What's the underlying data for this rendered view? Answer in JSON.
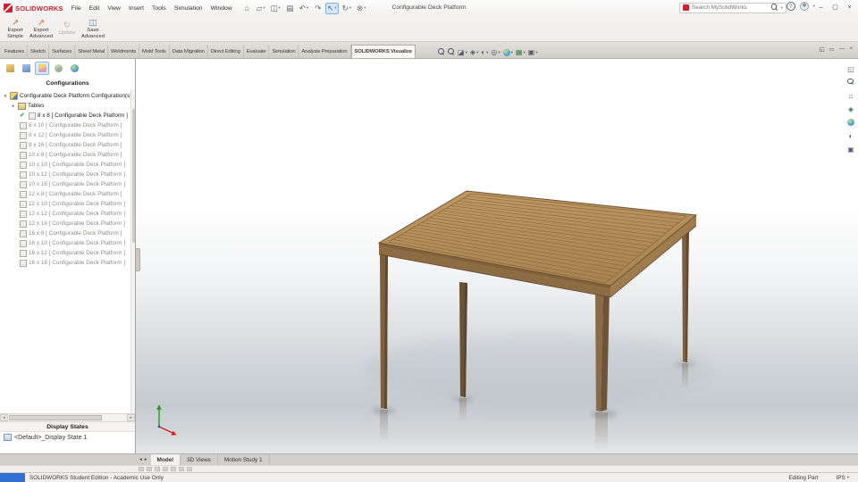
{
  "colors": {
    "brand_red": "#cf2030",
    "check_green": "#1e9b3a",
    "selection_blue": "#7fb0e0",
    "taskbar_blue": "#2f6fd6",
    "wood_top": "#b8935f",
    "wood_shadow": "#6d5438",
    "axis_x": "#d22020",
    "axis_y": "#1f9e1f",
    "axis_z": "#2b55cf"
  },
  "ui": {
    "caret_down": "▾",
    "caret_expanded": "▾",
    "caret_collapsed": "▸",
    "check": "✔",
    "arrow_left": "◂",
    "arrow_right": "▸"
  },
  "titlebar": {
    "logo_text": "SOLIDWORKS",
    "menus": [
      "File",
      "Edit",
      "View",
      "Insert",
      "Tools",
      "Simulation",
      "Window"
    ],
    "toolbar_icons": [
      {
        "name": "home",
        "glyph": "⌂"
      },
      {
        "name": "open",
        "glyph": "▱"
      },
      {
        "name": "save",
        "glyph": "◫"
      },
      {
        "name": "print",
        "glyph": "▤"
      },
      {
        "name": "undo",
        "glyph": "↶"
      },
      {
        "name": "redo",
        "glyph": "↷"
      },
      {
        "name": "select",
        "glyph": "↖"
      },
      {
        "name": "rebuild",
        "glyph": "↻"
      },
      {
        "name": "options",
        "glyph": "⊛"
      }
    ],
    "document_title": "Configurable Deck Platform",
    "search_placeholder": "Search MySolidWorks",
    "help_glyph": "?",
    "window_controls": {
      "minimize": "–",
      "maximize": "▢",
      "close": "×"
    }
  },
  "ribbon": {
    "buttons": [
      {
        "line1": "Export",
        "line2": "Simple",
        "glyph": "↗",
        "disabled": false
      },
      {
        "line1": "Export",
        "line2": "Advanced",
        "glyph": "↗",
        "disabled": false
      },
      {
        "line1": "Update",
        "line2": "",
        "glyph": "↻",
        "disabled": true
      },
      {
        "line1": "Save",
        "line2": "Advanced",
        "glyph": "◫",
        "disabled": false
      }
    ]
  },
  "command_tabs": {
    "items": [
      "Features",
      "Sketch",
      "Surfaces",
      "Sheet Metal",
      "Weldments",
      "Mold Tools",
      "Data Migration",
      "Direct Editing",
      "Evaluate",
      "Simulation",
      "Analysis Preparation",
      "SOLIDWORKS Visualize"
    ],
    "active": "SOLIDWORKS Visualize"
  },
  "headsup_icons": [
    {
      "name": "zoom-fit",
      "glyph": ""
    },
    {
      "name": "zoom-area",
      "glyph": ""
    },
    {
      "name": "section-view",
      "glyph": "◪"
    },
    {
      "name": "view-orientation",
      "glyph": "◈"
    },
    {
      "name": "display-style",
      "glyph": "◐"
    },
    {
      "name": "hide-show-items",
      "glyph": "◎"
    },
    {
      "name": "edit-appearance",
      "glyph": ""
    },
    {
      "name": "scene",
      "glyph": "▦"
    },
    {
      "name": "view-settings",
      "glyph": "▣"
    }
  ],
  "pane_controls": [
    {
      "name": "pop-out",
      "glyph": "◱"
    },
    {
      "name": "collapse",
      "glyph": "▭"
    },
    {
      "name": "minimize",
      "glyph": "—"
    },
    {
      "name": "close",
      "glyph": "×"
    }
  ],
  "manager_tabs": [
    "featuremanager",
    "propertymanager",
    "configurationmanager",
    "dimxpertmanager",
    "displaymanager"
  ],
  "config_panel": {
    "header": "Configurations",
    "root_label": "Configurable Deck Platform Configuration(s)",
    "tables_label": "Tables",
    "configurations": [
      {
        "name": "8 x 8 [ Configurable Deck Platform ]",
        "active": true
      },
      {
        "name": "8 x 10 [ Configurable Deck Platform ]",
        "active": false
      },
      {
        "name": "8 x 12 [ Configurable Deck Platform ]",
        "active": false
      },
      {
        "name": "8 x 16 [ Configurable Deck Platform ]",
        "active": false
      },
      {
        "name": "10 x 8 [ Configurable Deck Platform ]",
        "active": false
      },
      {
        "name": "10 x 10 [ Configurable Deck Platform ]",
        "active": false
      },
      {
        "name": "10 x 12 [ Configurable Deck Platform ]",
        "active": false
      },
      {
        "name": "10 x 16 [ Configurable Deck Platform ]",
        "active": false
      },
      {
        "name": "12 x 8 [ Configurable Deck Platform ]",
        "active": false
      },
      {
        "name": "12 x 10 [ Configurable Deck Platform ]",
        "active": false
      },
      {
        "name": "12 x 12 [ Configurable Deck Platform ]",
        "active": false
      },
      {
        "name": "12 x 16 [ Configurable Deck Platform ]",
        "active": false
      },
      {
        "name": "16 x 8 [ Configurable Deck Platform ]",
        "active": false
      },
      {
        "name": "16 x 10 [ Configurable Deck Platform ]",
        "active": false
      },
      {
        "name": "16 x 12 [ Configurable Deck Platform ]",
        "active": false
      },
      {
        "name": "16 x 16 [ Configurable Deck Platform ]",
        "active": false
      }
    ],
    "display_states_header": "Display States",
    "display_state": "<Default>_Display State 1"
  },
  "right_rail_icons": [
    {
      "name": "fullscreen",
      "glyph": "◱"
    },
    {
      "name": "zoom-to-fit",
      "glyph": ""
    },
    {
      "name": "home-view",
      "glyph": "⌂"
    },
    {
      "name": "view-cube",
      "glyph": "◈"
    },
    {
      "name": "render-sphere",
      "glyph": ""
    },
    {
      "name": "display-mode",
      "glyph": "◐"
    },
    {
      "name": "settings",
      "glyph": "▣"
    }
  ],
  "bottom_tabs": {
    "items": [
      "Model",
      "3D Views",
      "Motion Study 1"
    ],
    "active": "Model"
  },
  "statusbar": {
    "left_text": "SOLIDWORKS Student Edition - Academic Use Only",
    "mode_text": "Editing Part",
    "units": "IPS"
  }
}
